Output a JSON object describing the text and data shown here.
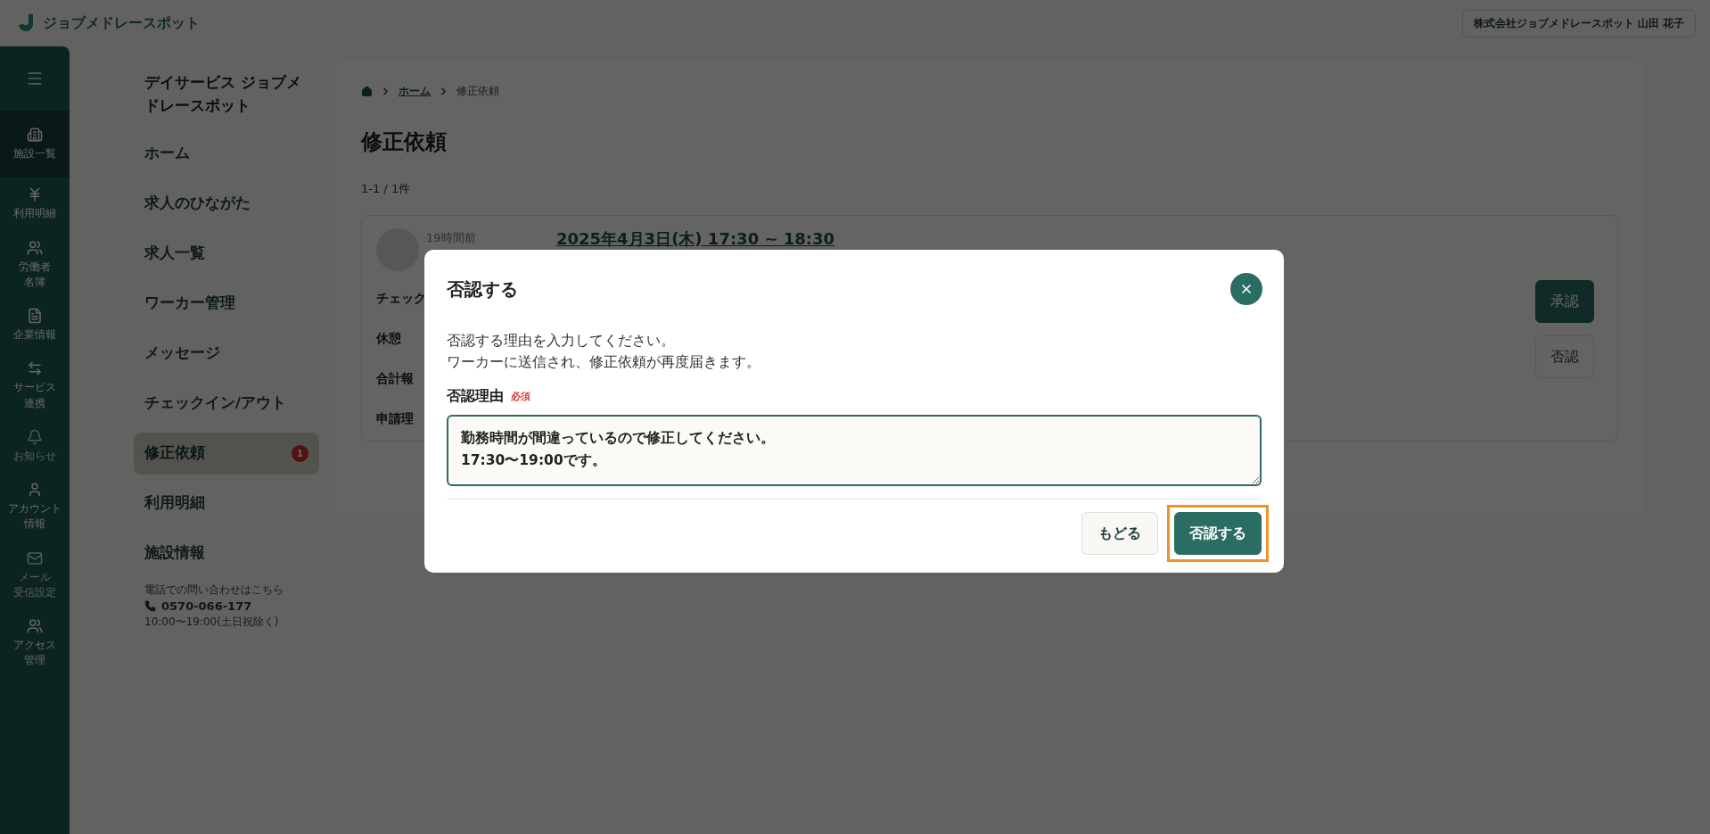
{
  "header": {
    "logo_text": "ジョブメドレースポット",
    "account": "株式会社ジョブメドレースポット 山田 花子"
  },
  "rail": {
    "items": [
      {
        "lines": [
          "施設一覧"
        ],
        "selected": true,
        "disabled": false
      },
      {
        "lines": [
          "利用明細"
        ],
        "selected": false,
        "disabled": false
      },
      {
        "lines": [
          "労働者",
          "名簿"
        ],
        "selected": false,
        "disabled": false
      },
      {
        "lines": [
          "企業情報"
        ],
        "selected": false,
        "disabled": false
      },
      {
        "lines": [
          "サービス",
          "連携"
        ],
        "selected": false,
        "disabled": false
      },
      {
        "lines": [
          "お知らせ"
        ],
        "selected": false,
        "disabled": true
      },
      {
        "lines": [
          "アカウント",
          "情報"
        ],
        "selected": false,
        "disabled": false
      },
      {
        "lines": [
          "メール",
          "受信設定"
        ],
        "selected": false,
        "disabled": true
      },
      {
        "lines": [
          "アクセス",
          "管理"
        ],
        "selected": false,
        "disabled": false
      }
    ]
  },
  "sidebar": {
    "facility": "デイサービス ジョブメドレースポット",
    "items": [
      {
        "label": "ホーム",
        "selected": false
      },
      {
        "label": "求人のひながた",
        "selected": false
      },
      {
        "label": "求人一覧",
        "selected": false
      },
      {
        "label": "ワーカー管理",
        "selected": false
      },
      {
        "label": "メッセージ",
        "selected": false
      },
      {
        "label": "チェックイン/アウト",
        "selected": false
      },
      {
        "label": "修正依頼",
        "selected": true,
        "badge": "1"
      },
      {
        "label": "利用明細",
        "selected": false
      },
      {
        "label": "施設情報",
        "selected": false
      }
    ],
    "contact": {
      "note": "電話での問い合わせはこちら",
      "phone": "0570-066-177",
      "hours": "10:00〜19:00(土日祝除く)"
    }
  },
  "breadcrumb": {
    "link": "ホーム",
    "current": "修正依頼"
  },
  "page_title": "修正依頼",
  "count": "1-1 / 1件",
  "request": {
    "ago": "19時間前",
    "date": "2025年4月3日(木) 17:30 ~ 18:30",
    "labels": [
      "チェック",
      "休憩",
      "合計報",
      "申請理"
    ],
    "approve": "承認",
    "reject": "否認"
  },
  "dialog": {
    "title": "否認する",
    "description": [
      "否認する理由を入力してください。",
      "ワーカーに送信され、修正依頼が再度届きます。"
    ],
    "field_label": "否認理由",
    "required": "必須",
    "value": "勤務時間が間違っているので修正してください。\n17:30〜19:00です。",
    "buttons": [
      {
        "kind": "secondary",
        "label": "もどる",
        "highlighted": false
      },
      {
        "kind": "primary",
        "label": "否認する",
        "highlighted": true
      }
    ]
  }
}
